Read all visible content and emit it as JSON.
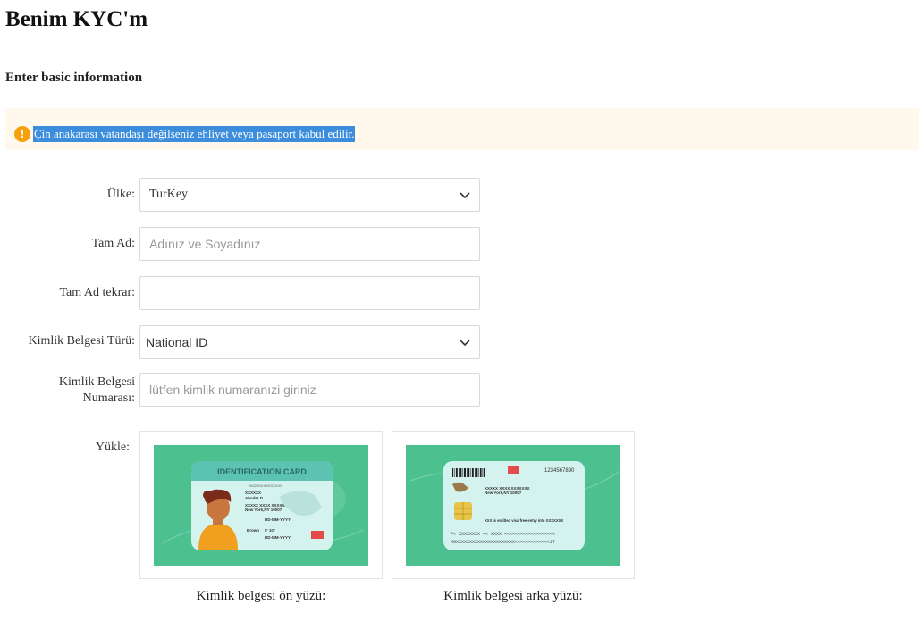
{
  "page": {
    "title": "Benim KYC'm",
    "section_title": "Enter basic information"
  },
  "notice": {
    "text": "Çin anakarası vatandaşı değilseniz ehliyet veya pasaport kabul edilir.",
    "icon": "warning-circle-icon",
    "accent_color": "#f5a00c"
  },
  "form": {
    "country": {
      "label": "Ülke:",
      "value": "TurKey"
    },
    "full_name": {
      "label": "Tam Ad:",
      "value": "",
      "placeholder": "Adınız ve Soyadınız"
    },
    "full_name_repeat": {
      "label": "Tam Ad tekrar:",
      "value": "",
      "placeholder": ""
    },
    "id_type": {
      "label": "Kimlik Belgesi Türü:",
      "value": "National ID"
    },
    "id_number": {
      "label_line1": "Kimlik Belgesi",
      "label_line2": "Numarası:",
      "value": "",
      "placeholder": "lütfen kimlik numaranızi giriniz"
    },
    "upload": {
      "label": "Yükle:"
    }
  },
  "uploads": {
    "front": {
      "caption": "Kimlik belgesi ön yüzü:",
      "card_title": "IDENTIFICATION CARD",
      "id_no": "26225XXXXXXXXXX",
      "name": "XXXXXX",
      "surname": "AbodeLD",
      "address1": "XXXXX XXXX XXXXXXX",
      "address2": "New York,NY 10007",
      "dob": "DD-MM-YYYY",
      "eyes": "Brown",
      "height": "5' 10\"",
      "expires": "DD-MM-YYYY"
    },
    "back": {
      "caption": "Kimlik belgesi arka yüzü:",
      "number": "1234567890",
      "address1": "XXXXX XXXX XXXXXXX",
      "address2": "New York,NY 10007",
      "entitled": "XXX is entitled visa free entry into XXXXXXX",
      "mrz1": "P< XXXXXXXX << XXXX <<<<<<<<<<<<<<<<<<<",
      "mrz2": "MGXXXXXXXXXXXXXXXXXXXXXX<<<<<<<<<<<<<17"
    }
  },
  "colors": {
    "card_bg": "#4cc08f",
    "card_face": "#d4f2ee",
    "card_header": "#5cc2b2"
  }
}
